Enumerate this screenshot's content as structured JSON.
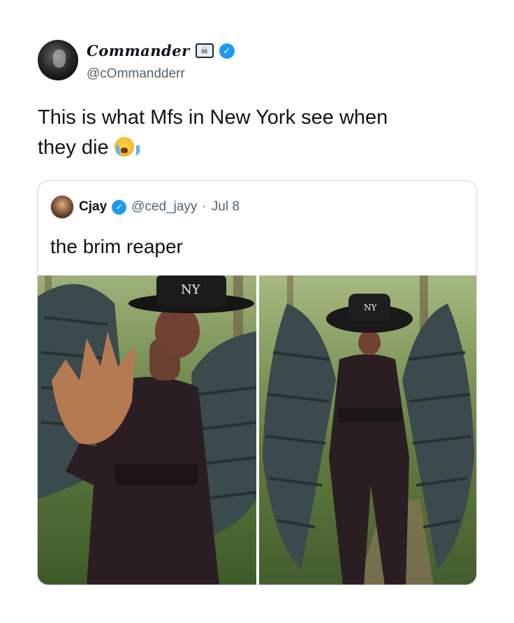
{
  "tweet": {
    "display_name": "Commander",
    "name_badge_icon": "skull-crossbones-icon",
    "verified_icon": "verified-check-icon",
    "handle": "@cOmmandderr",
    "text_line1": "This is what Mfs in New York see when",
    "text_line2": "they die",
    "emoji": "loudly-crying-face-emoji"
  },
  "quoted_tweet": {
    "display_name": "Cjay",
    "verified_icon": "verified-check-icon",
    "handle": "@ced_jayy",
    "separator": "·",
    "date": "Jul 8",
    "text": "the brim reaper",
    "media": [
      {
        "icon": "photo-person-wings-hand-raised"
      },
      {
        "icon": "photo-person-wings-standing"
      }
    ]
  },
  "colors": {
    "verified_blue": "#1d9bf0",
    "handle_gray": "#536471",
    "border": "#cfd9de"
  }
}
